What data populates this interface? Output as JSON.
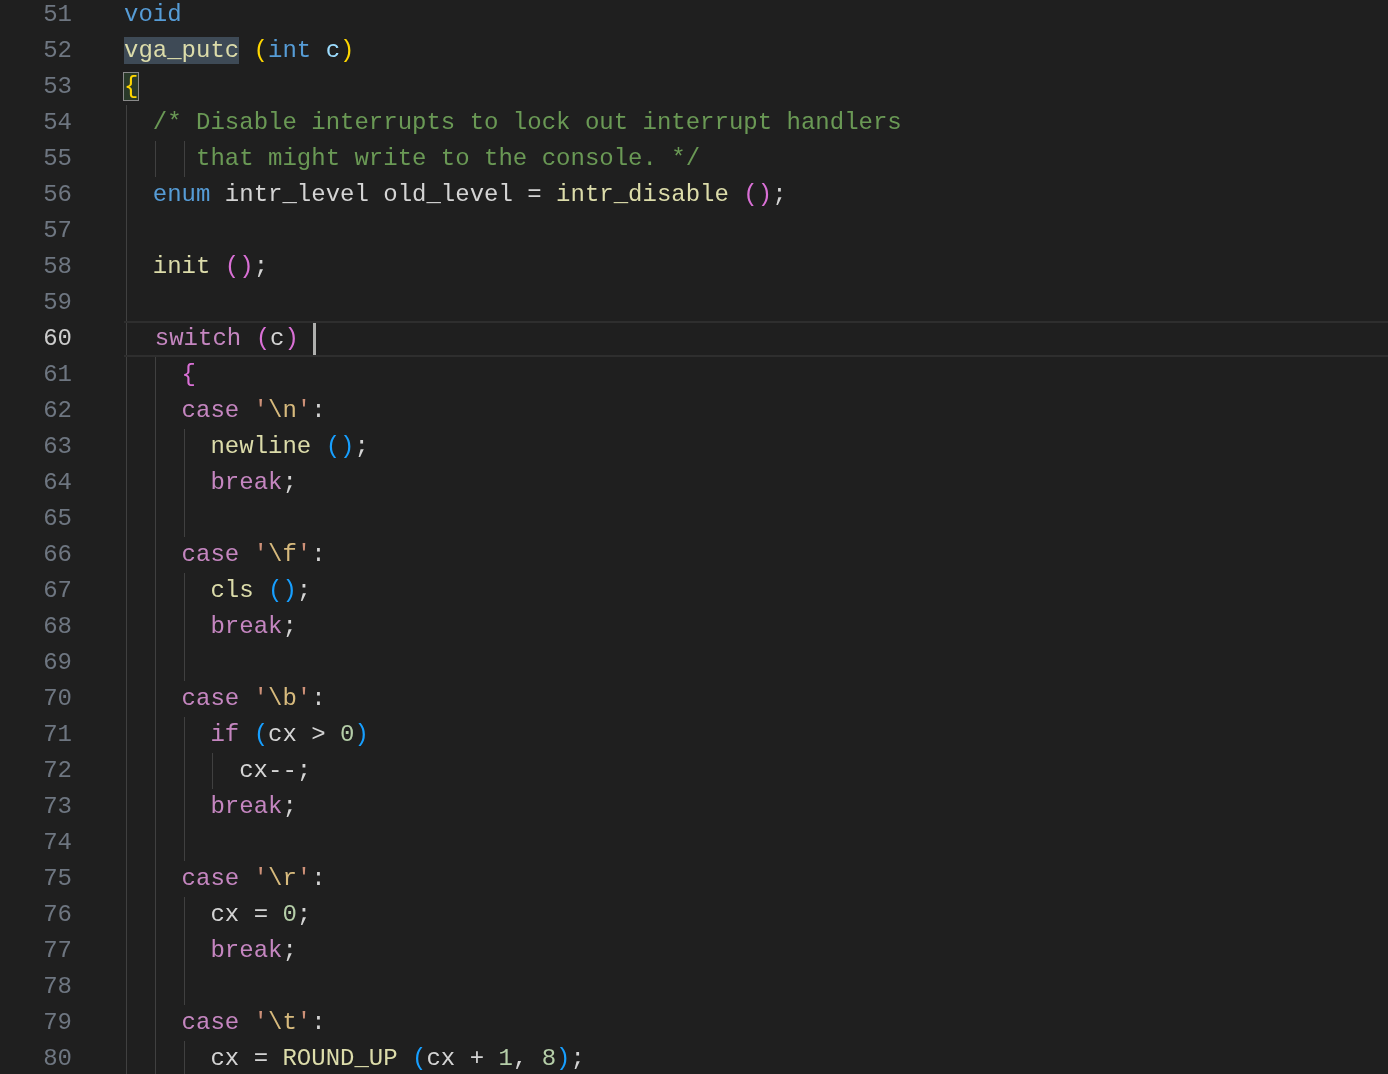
{
  "editor": {
    "lines": [
      {
        "number": "51",
        "current": false,
        "tokens": [
          {
            "text": "void",
            "kind": "type"
          }
        ]
      },
      {
        "number": "52",
        "current": false,
        "tokens": [
          {
            "text": "vga_putc",
            "kind": "selection"
          },
          {
            "text": " (",
            "kind": "b1"
          },
          {
            "text": "int",
            "kind": "type"
          },
          {
            "text": " c",
            "kind": "param"
          },
          {
            "text": ")",
            "kind": "b1"
          }
        ]
      },
      {
        "number": "53",
        "current": false,
        "tokens": [
          {
            "text": "{",
            "kind": "match"
          }
        ]
      },
      {
        "number": "54",
        "current": false,
        "tokens": [
          {
            "text": "  /* Disable interrupts to lock out interrupt handlers",
            "kind": "comment"
          }
        ]
      },
      {
        "number": "55",
        "current": false,
        "tokens": [
          {
            "text": "     that might write to the console. */",
            "kind": "comment"
          }
        ]
      },
      {
        "number": "56",
        "current": false,
        "tokens": [
          {
            "text": "  enum",
            "kind": "type"
          },
          {
            "text": " intr_level old_level = ",
            "kind": "plain"
          },
          {
            "text": "intr_disable",
            "kind": "function"
          },
          {
            "text": " ()",
            "kind": "b2"
          },
          {
            "text": ";",
            "kind": "plain"
          }
        ]
      },
      {
        "number": "57",
        "current": false
      },
      {
        "number": "58",
        "current": false,
        "tokens": [
          {
            "text": "  init",
            "kind": "function"
          },
          {
            "text": " ()",
            "kind": "b2"
          },
          {
            "text": ";",
            "kind": "plain"
          }
        ]
      },
      {
        "number": "59",
        "current": false
      },
      {
        "number": "60",
        "current": true,
        "tokens": [
          {
            "text": "  switch",
            "kind": "control"
          },
          {
            "text": " (",
            "kind": "b2"
          },
          {
            "text": "c",
            "kind": "plain"
          },
          {
            "text": ")",
            "kind": "b2"
          }
        ]
      },
      {
        "number": "61",
        "current": false,
        "tokens": [
          {
            "text": "    {",
            "kind": "b2"
          }
        ]
      },
      {
        "number": "62",
        "current": false,
        "tokens": [
          {
            "text": "    case",
            "kind": "control"
          },
          {
            "text": " '",
            "kind": "string"
          },
          {
            "text": "\\n",
            "kind": "escape"
          },
          {
            "text": "'",
            "kind": "string"
          },
          {
            "text": ":",
            "kind": "plain"
          }
        ]
      },
      {
        "number": "63",
        "current": false,
        "tokens": [
          {
            "text": "      newline",
            "kind": "function"
          },
          {
            "text": " ()",
            "kind": "b3"
          },
          {
            "text": ";",
            "kind": "plain"
          }
        ]
      },
      {
        "number": "64",
        "current": false,
        "tokens": [
          {
            "text": "      break",
            "kind": "control"
          },
          {
            "text": ";",
            "kind": "plain"
          }
        ]
      },
      {
        "number": "65",
        "current": false
      },
      {
        "number": "66",
        "current": false,
        "tokens": [
          {
            "text": "    case",
            "kind": "control"
          },
          {
            "text": " '",
            "kind": "string"
          },
          {
            "text": "\\f",
            "kind": "escape"
          },
          {
            "text": "'",
            "kind": "string"
          },
          {
            "text": ":",
            "kind": "plain"
          }
        ]
      },
      {
        "number": "67",
        "current": false,
        "tokens": [
          {
            "text": "      cls",
            "kind": "function"
          },
          {
            "text": " ()",
            "kind": "b3"
          },
          {
            "text": ";",
            "kind": "plain"
          }
        ]
      },
      {
        "number": "68",
        "current": false,
        "tokens": [
          {
            "text": "      break",
            "kind": "control"
          },
          {
            "text": ";",
            "kind": "plain"
          }
        ]
      },
      {
        "number": "69",
        "current": false
      },
      {
        "number": "70",
        "current": false,
        "tokens": [
          {
            "text": "    case",
            "kind": "control"
          },
          {
            "text": " '",
            "kind": "string"
          },
          {
            "text": "\\b",
            "kind": "escape"
          },
          {
            "text": "'",
            "kind": "string"
          },
          {
            "text": ":",
            "kind": "plain"
          }
        ]
      },
      {
        "number": "71",
        "current": false,
        "tokens": [
          {
            "text": "      if",
            "kind": "control"
          },
          {
            "text": " (",
            "kind": "b3"
          },
          {
            "text": "cx > ",
            "kind": "plain"
          },
          {
            "text": "0",
            "kind": "number"
          },
          {
            "text": ")",
            "kind": "b3"
          }
        ]
      },
      {
        "number": "72",
        "current": false,
        "tokens": [
          {
            "text": "        cx--;",
            "kind": "plain"
          }
        ]
      },
      {
        "number": "73",
        "current": false,
        "tokens": [
          {
            "text": "      break",
            "kind": "control"
          },
          {
            "text": ";",
            "kind": "plain"
          }
        ]
      },
      {
        "number": "74",
        "current": false
      },
      {
        "number": "75",
        "current": false,
        "tokens": [
          {
            "text": "    case",
            "kind": "control"
          },
          {
            "text": " '",
            "kind": "string"
          },
          {
            "text": "\\r",
            "kind": "escape"
          },
          {
            "text": "'",
            "kind": "string"
          },
          {
            "text": ":",
            "kind": "plain"
          }
        ]
      },
      {
        "number": "76",
        "current": false,
        "tokens": [
          {
            "text": "      cx = ",
            "kind": "plain"
          },
          {
            "text": "0",
            "kind": "number"
          },
          {
            "text": ";",
            "kind": "plain"
          }
        ]
      },
      {
        "number": "77",
        "current": false,
        "tokens": [
          {
            "text": "      break",
            "kind": "control"
          },
          {
            "text": ";",
            "kind": "plain"
          }
        ]
      },
      {
        "number": "78",
        "current": false
      },
      {
        "number": "79",
        "current": false,
        "tokens": [
          {
            "text": "    case",
            "kind": "control"
          },
          {
            "text": " '",
            "kind": "string"
          },
          {
            "text": "\\t",
            "kind": "escape"
          },
          {
            "text": "'",
            "kind": "string"
          },
          {
            "text": ":",
            "kind": "plain"
          }
        ]
      },
      {
        "number": "80",
        "current": false,
        "tokens": [
          {
            "text": "      cx = ",
            "kind": "plain"
          },
          {
            "text": "ROUND_UP",
            "kind": "function"
          },
          {
            "text": " (",
            "kind": "b3"
          },
          {
            "text": "cx + ",
            "kind": "plain"
          },
          {
            "text": "1",
            "kind": "number"
          },
          {
            "text": ", ",
            "kind": "plain"
          },
          {
            "text": "8",
            "kind": "number"
          },
          {
            "text": ")",
            "kind": "b3"
          },
          {
            "text": ";",
            "kind": "plain"
          }
        ]
      }
    ]
  }
}
